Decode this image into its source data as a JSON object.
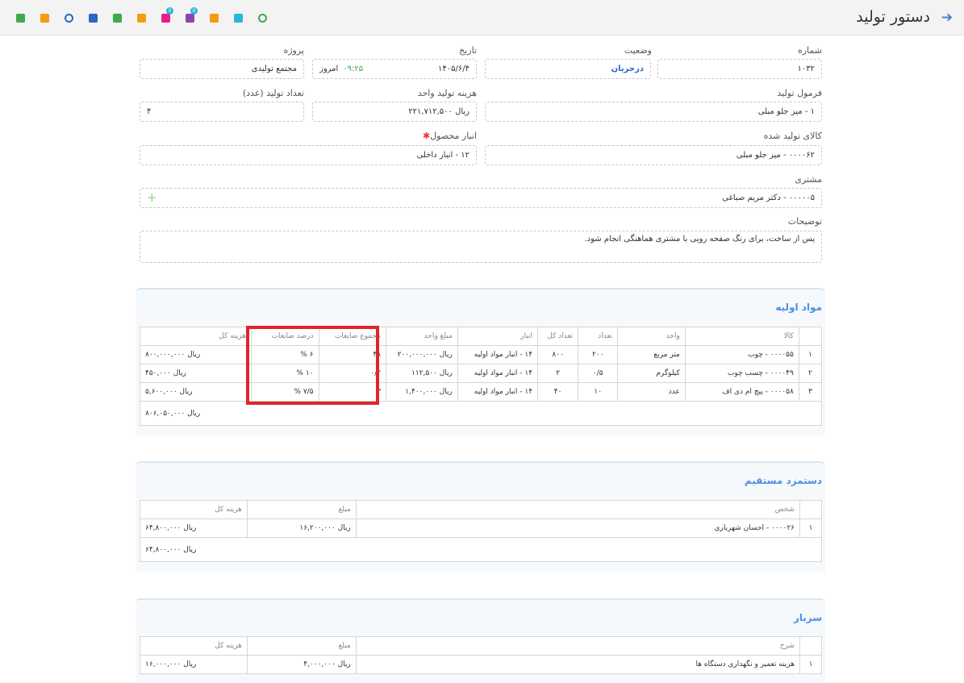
{
  "header": {
    "title": "دستور تولید",
    "back_icon": "arrow-right-icon",
    "toolbar": [
      {
        "name": "save-icon",
        "color": "#3fa94b"
      },
      {
        "name": "add-document-icon",
        "color": "#f39c12"
      },
      {
        "name": "history-icon",
        "color": "#2a66c2"
      },
      {
        "name": "print-icon",
        "color": "#2a66c2"
      },
      {
        "name": "excel-icon",
        "color": "#3fa94b"
      },
      {
        "name": "export-icon",
        "color": "#f39c12"
      },
      {
        "name": "email-icon",
        "color": "#e91e8c",
        "badge": "0"
      },
      {
        "name": "message-icon",
        "color": "#8e44ad",
        "badge": "0"
      },
      {
        "name": "copy-icon",
        "color": "#f39c12"
      },
      {
        "name": "refresh-icon",
        "color": "#29b6d9"
      },
      {
        "name": "confirm-icon",
        "color": "#3fa94b"
      }
    ]
  },
  "form": {
    "number_label": "شماره",
    "number_value": "۱۰۳۲",
    "status_label": "وضعیت",
    "status_value": "درجریان",
    "date_label": "تاریخ",
    "date_value": "۱۴۰۵/۶/۴",
    "time_value": "۰۹:۲۵",
    "today_label": "امروز",
    "project_label": "پروژه",
    "project_value": "مجتمع تولیدی",
    "formula_label": "فرمول تولید",
    "formula_value": "۱ - میز جلو مبلی",
    "unit_cost_label": "هزینه تولید واحد",
    "unit_cost_value": "ریال ۲۲۱,۷۱۲,۵۰۰",
    "qty_label": "تعداد تولید (عدد)",
    "qty_value": "۴",
    "product_label": "کالای تولید شده",
    "product_value": "۰۰۰۰۶۲ - میز جلو مبلی",
    "warehouse_label": "انبار محصول",
    "warehouse_required": "✱",
    "warehouse_value": "۱۲ - انبار داخلی",
    "customer_label": "مشتری",
    "customer_value": "۰۰۰۰۰۵ - دکتر مریم صباغی",
    "customer_add": "+",
    "notes_label": "توضیحات",
    "notes_value": "پس از ساخت، برای رنگ صفحه رویی با مشتری هماهنگی انجام شود."
  },
  "materials": {
    "title": "مواد اولیه",
    "columns": [
      "",
      "کالا",
      "واحد",
      "تعداد",
      "تعداد کل",
      "انبار",
      "مبلغ واحد",
      "مجموع ضایعات",
      "درصد ضایعات",
      "هزینه کل"
    ],
    "rows": [
      [
        "۱",
        "۰۰۰۰۵۵ - چوب",
        "متر مربع",
        "۲۰۰",
        "۸۰۰",
        "۱۴ - انبار مواد اولیه",
        "ریال ۲۰۰,۰۰۰,۰۰۰",
        "۴۸",
        "۶ %",
        "ریال ۸۰۰,۰۰۰,۰۰۰"
      ],
      [
        "۲",
        "۰۰۰۰۴۹ - چسب چوب",
        "کیلوگرم",
        "۰/۵",
        "۲",
        "۱۴ - انبار مواد اولیه",
        "ریال ۱۱۲,۵۰۰",
        "۰/۲",
        "۱۰ %",
        "ریال ۴۵۰,۰۰۰"
      ],
      [
        "۳",
        "۰۰۰۰۵۸ - پیچ ام دی اف",
        "عدد",
        "۱۰",
        "۴۰",
        "۱۴ - انبار مواد اولیه",
        "ریال ۱,۴۰۰,۰۰۰",
        "۳",
        "۷/۵ %",
        "ریال ۵,۶۰۰,۰۰۰"
      ]
    ],
    "total": "ریال ۸۰۶,۰۵۰,۰۰۰"
  },
  "labor": {
    "title": "دستمزد مستقیم",
    "columns": [
      "",
      "شخص",
      "مبلغ",
      "هزینه کل"
    ],
    "rows": [
      [
        "۱",
        "۰۰۰۰۲۶ - احسان شهریاری",
        "ریال ۱۶,۲۰۰,۰۰۰",
        "ریال ۶۴,۸۰۰,۰۰۰"
      ]
    ],
    "total": "ریال ۶۴,۸۰۰,۰۰۰"
  },
  "overhead": {
    "title": "سربار",
    "columns": [
      "",
      "شرح",
      "مبلغ",
      "هزینه کل"
    ],
    "rows": [
      [
        "۱",
        "هزینه تعمیر و نگهداری دستگاه ها",
        "ریال ۴,۰۰۰,۰۰۰",
        "ریال ۱۶,۰۰۰,۰۰۰"
      ]
    ]
  },
  "highlight_color": "#e0242b"
}
